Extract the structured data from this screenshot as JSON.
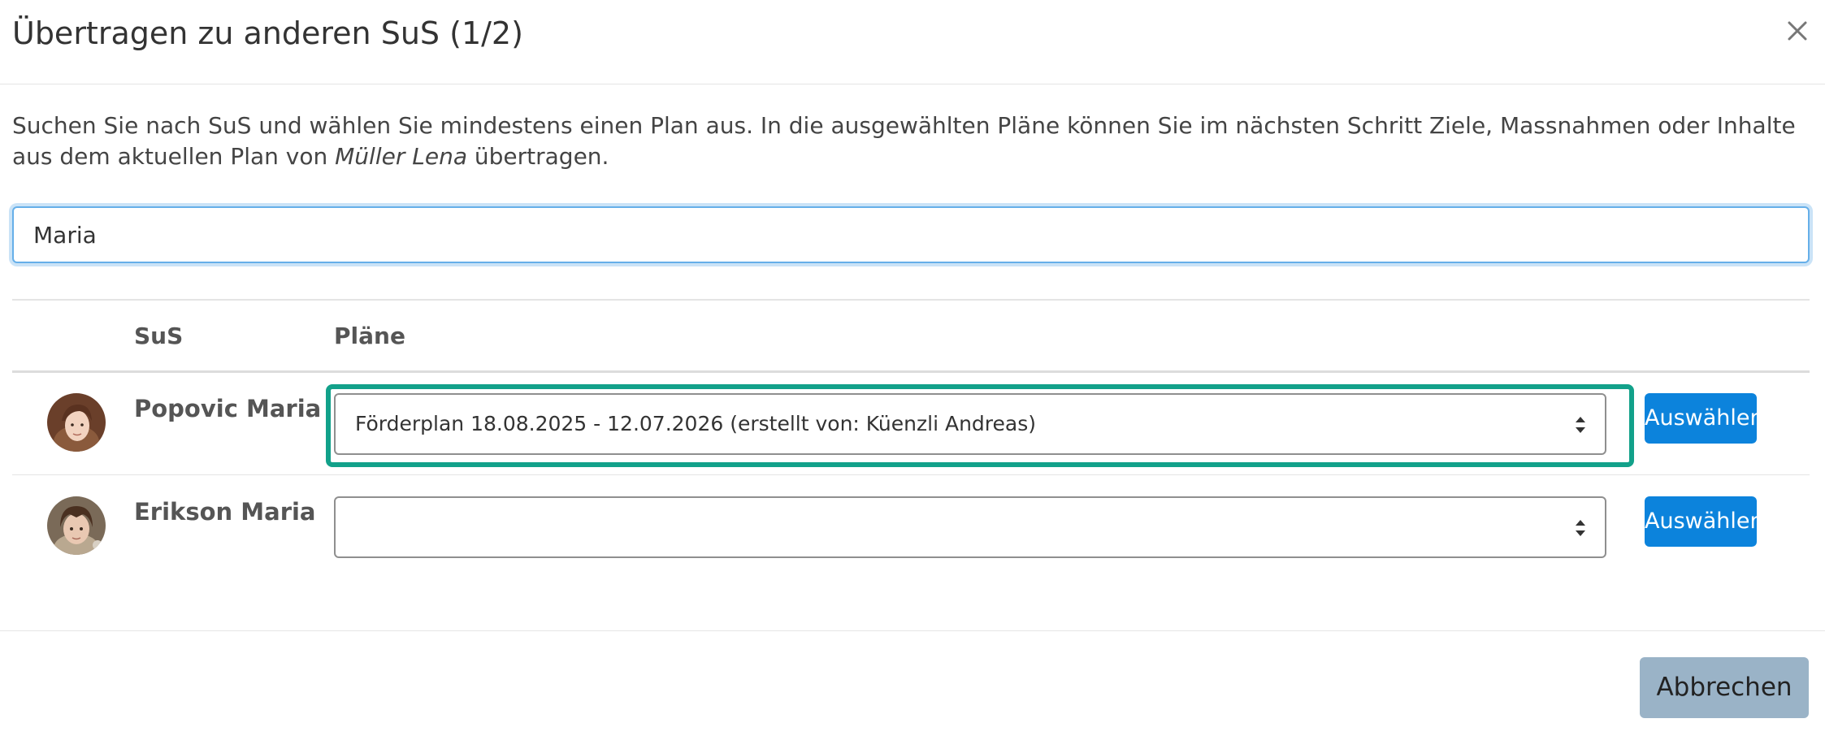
{
  "dialog": {
    "title": "Übertragen zu anderen SuS (1/2)",
    "close_icon": "close-icon"
  },
  "description": {
    "part1": "Suchen Sie nach SuS und wählen Sie mindestens einen Plan aus. In die ausgewählten Pläne können Sie im nächsten Schritt Ziele, Massnahmen oder Inhalte aus dem aktuellen Plan von ",
    "name": "Müller Lena",
    "part2": " übertragen."
  },
  "search": {
    "value": "Maria"
  },
  "table": {
    "headers": {
      "sus": "SuS",
      "plaene": "Pläne"
    },
    "rows": [
      {
        "name": "Popovic Maria",
        "plan": "Förderplan 18.08.2025 - 12.07.2026 (erstellt von: Küenzli Andreas)",
        "button": "Auswählen",
        "highlighted": true
      },
      {
        "name": "Erikson Maria",
        "plan": "",
        "button": "Auswählen",
        "highlighted": false
      }
    ]
  },
  "footer": {
    "cancel_label": "Abbrechen"
  },
  "colors": {
    "primary": "#0c83dc",
    "highlight": "#12a18a",
    "cancel": "#9ab3c7",
    "focus": "#66afe9"
  }
}
